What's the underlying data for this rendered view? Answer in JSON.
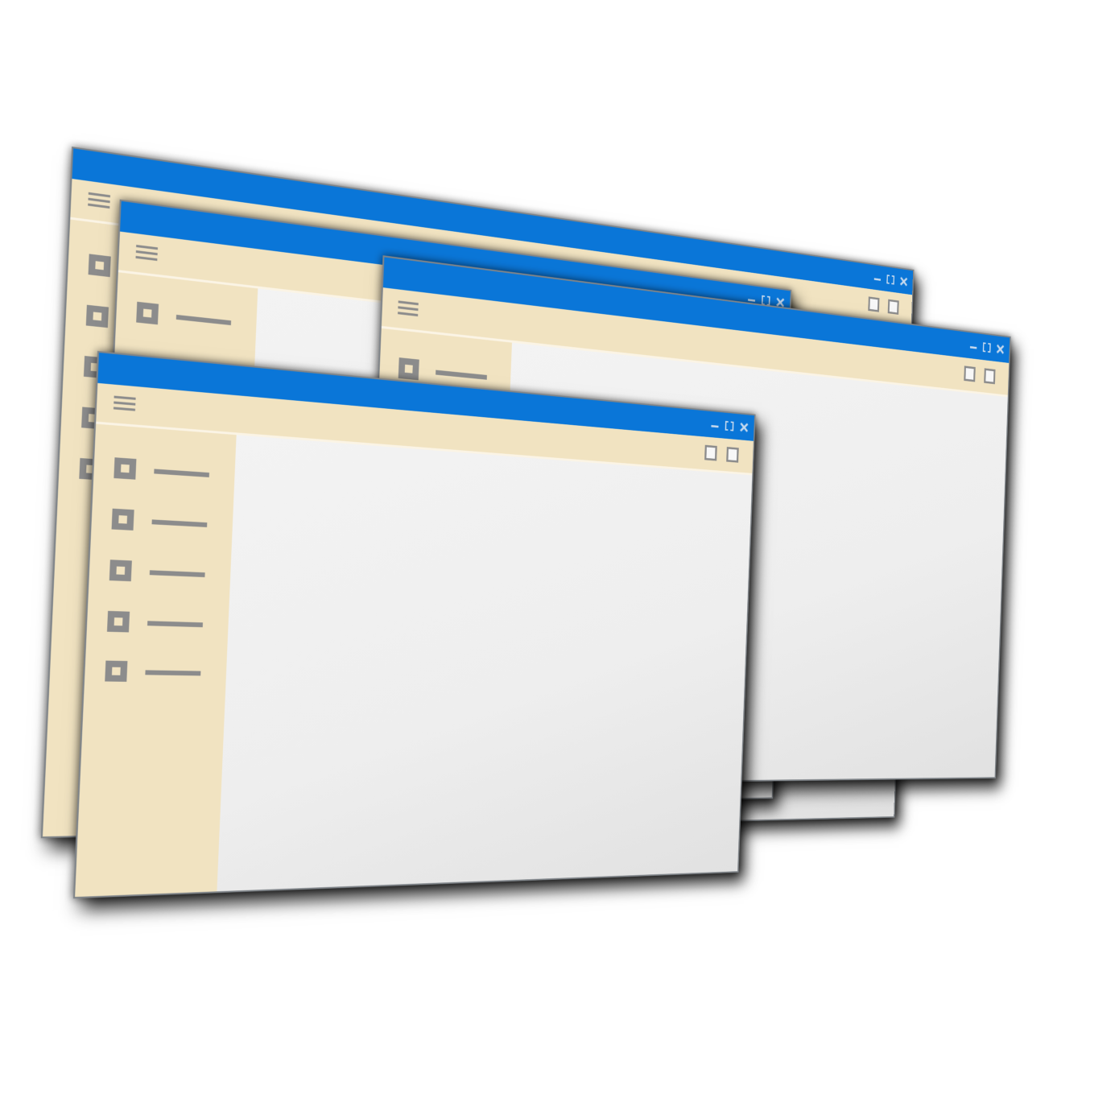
{
  "colors": {
    "titlebar": "#0a76d8",
    "menubar": "#f1e3c1",
    "content": "#f0f0f0",
    "icon_gray": "#8c8c8c"
  },
  "windows": [
    {
      "id": "back",
      "controls": [
        "minimize-icon",
        "maximize-icon",
        "close-icon"
      ],
      "toolbar_buttons": 2,
      "sidebar_items": 5
    },
    {
      "id": "second",
      "controls": [
        "minimize-icon",
        "maximize-icon",
        "close-icon"
      ],
      "toolbar_buttons": 2,
      "sidebar_items": 1
    },
    {
      "id": "third",
      "controls": [
        "minimize-icon",
        "maximize-icon",
        "close-icon"
      ],
      "toolbar_buttons": 2,
      "sidebar_items": 1
    },
    {
      "id": "front",
      "controls": [
        "minimize-icon",
        "maximize-icon",
        "close-icon"
      ],
      "toolbar_buttons": 2,
      "sidebar_items": 5
    }
  ]
}
